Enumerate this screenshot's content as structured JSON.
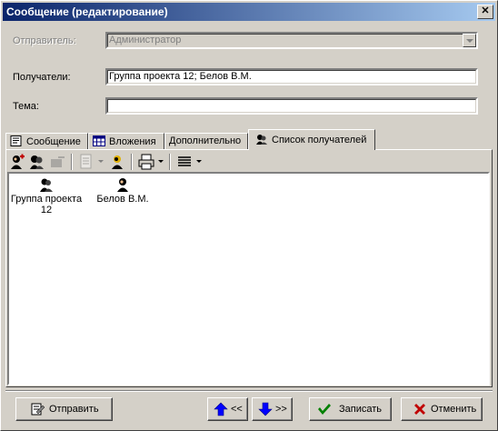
{
  "window": {
    "title": "Сообщение (редактирование)",
    "close_label": "✕"
  },
  "form": {
    "sender": {
      "label": "Отправитель:",
      "value": "Администратор"
    },
    "recipients": {
      "label": "Получатели:",
      "value": "Группа проекта 12; Белов В.М."
    },
    "subject": {
      "label": "Тема:",
      "value": ""
    }
  },
  "tabs": [
    {
      "label": "Сообщение",
      "icon": "message-icon",
      "active": false
    },
    {
      "label": "Вложения",
      "icon": "attachments-icon",
      "active": false
    },
    {
      "label": "Дополнительно",
      "icon": "",
      "active": false
    },
    {
      "label": "Список получателей",
      "icon": "recipients-icon",
      "active": true
    }
  ],
  "toolbar": {
    "icons": [
      "add-recipient-icon",
      "add-group-icon",
      "remove-icon",
      "properties-icon",
      "find-user-icon",
      "print-icon",
      "align-icon"
    ]
  },
  "recipients_list": [
    {
      "label_line1": "Группа проекта",
      "label_line2": "12",
      "icon": "group-icon"
    },
    {
      "label_line1": "Белов В.М.",
      "label_line2": "",
      "icon": "user-icon"
    }
  ],
  "buttons": {
    "send": "Отправить",
    "prev": "<<",
    "next": ">>",
    "save": "Записать",
    "cancel": "Отменить"
  },
  "colors": {
    "title_start": "#0a246a",
    "title_end": "#a6caf0",
    "face": "#d4d0c8"
  }
}
